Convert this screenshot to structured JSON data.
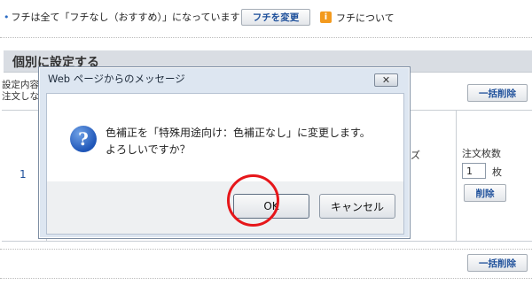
{
  "notice": {
    "bullet": "•",
    "text": "フチは全て「フチなし（おすすめ）」になっています",
    "change_button": "フチを変更",
    "info_icon_glyph": "i",
    "info_link": "フチについて"
  },
  "section": {
    "title": "個別に設定する",
    "description": "設定内容\n注文しな",
    "bulk_delete_label": "一括削除"
  },
  "table": {
    "row_number": "1",
    "partial_column_text": "ズ",
    "qty_label": "注文枚数",
    "qty_value": "1",
    "qty_unit": "枚",
    "delete_label": "削除"
  },
  "dialog": {
    "title": "Web ページからのメッセージ",
    "close_glyph": "✕",
    "icon_glyph": "?",
    "message_line1": "色補正を「特殊用途向け：色補正なし」に変更します。",
    "message_line2": "よろしいですか？",
    "ok_label": "OK",
    "cancel_label": "キャンセル"
  },
  "colors": {
    "highlight": "#e6161a",
    "link_blue": "#1d4f9a",
    "info_orange": "#f39a1e"
  }
}
